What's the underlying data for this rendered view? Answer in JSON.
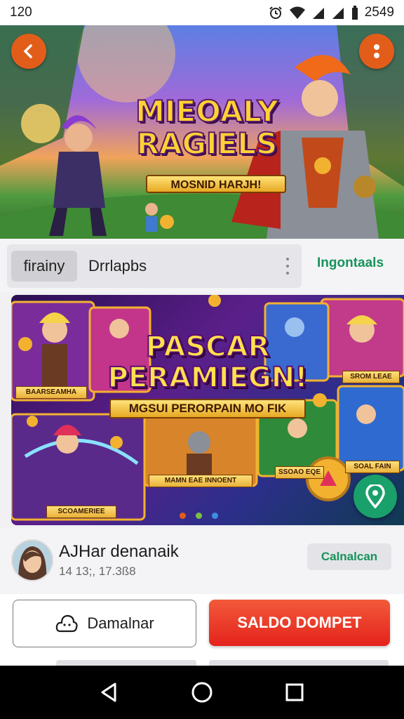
{
  "status_bar": {
    "time": "120",
    "right_text": "2549",
    "icons": [
      "alarm-icon",
      "wifi-icon",
      "signal-icon",
      "signal-icon",
      "battery-icon"
    ]
  },
  "hero": {
    "title": "MIEOALY\nRAGIELS",
    "subtitle": "MOSNID HARJH!",
    "back_icon": "chevron-left-icon",
    "menu_icon": "more-vertical-icon",
    "accent_color": "#e35d1a"
  },
  "tabs": {
    "active_label": "firainy",
    "second_label": "Drrlapbs",
    "link_label": "Ingontaals",
    "link_color": "#17935b"
  },
  "banner": {
    "title": "PASCAR\nPERAMIEGN!",
    "subtitle": "MGSUI PERORPAIN MO FIK",
    "card_labels": [
      "BAARSEAMHA",
      "SROM LEAE",
      "SCOAMERIEE",
      "MAMN EAE INNOENT",
      "SSOAO EQE",
      "SOAL FAIN"
    ],
    "carousel_dots": [
      "#e35d1a",
      "#7bc043",
      "#3b8fe0"
    ],
    "fab_icon": "location-pin-icon"
  },
  "user": {
    "name": "AJHar denanaik",
    "meta": "14 13;, 17.3ß8",
    "chip_label": "Calnalcan"
  },
  "actions": {
    "secondary_label": "Damalnar",
    "secondary_icon": "cloud-icon",
    "primary_label": "SALDO DOMPET",
    "primary_color": "#e4221c"
  },
  "nav": {
    "back_icon": "triangle-back-icon",
    "home_icon": "circle-home-icon",
    "recents_icon": "square-recents-icon"
  }
}
